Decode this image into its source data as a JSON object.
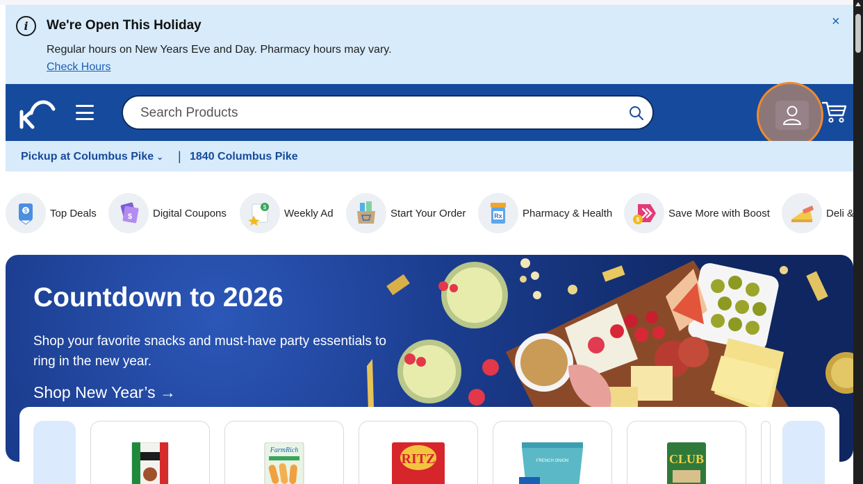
{
  "alert": {
    "title": "We're Open This Holiday",
    "text": "Regular hours on New Years Eve and Day. Pharmacy hours may vary.",
    "link": "Check Hours",
    "close": "×"
  },
  "header": {
    "search_placeholder": "Search Products"
  },
  "pickup": {
    "store": "Pickup at Columbus Pike",
    "chevron": "⌄",
    "separator": "|",
    "address": "1840 Columbus Pike"
  },
  "categories": [
    {
      "label": "Top Deals"
    },
    {
      "label": "Digital Coupons"
    },
    {
      "label": "Weekly Ad"
    },
    {
      "label": "Start Your Order"
    },
    {
      "label": "Pharmacy & Health"
    },
    {
      "label": "Save More with Boost"
    },
    {
      "label": "Deli &"
    }
  ],
  "hero": {
    "title": "Countdown to 2026",
    "text": "Shop your favorite snacks and must-have party essentials to ring in the new year.",
    "cta": "Shop New Year’s",
    "cta_arrow": "→"
  },
  "products": [
    {
      "brand": ""
    },
    {
      "brand": "FarmRich"
    },
    {
      "brand": "RITZ"
    },
    {
      "brand": "FRENCH ONION"
    },
    {
      "brand": "CLUB"
    }
  ],
  "colors": {
    "header": "#164a9c",
    "alert_bg": "#d8ebfb",
    "link": "#1a5fb4",
    "highlight": "#f08a2c"
  }
}
